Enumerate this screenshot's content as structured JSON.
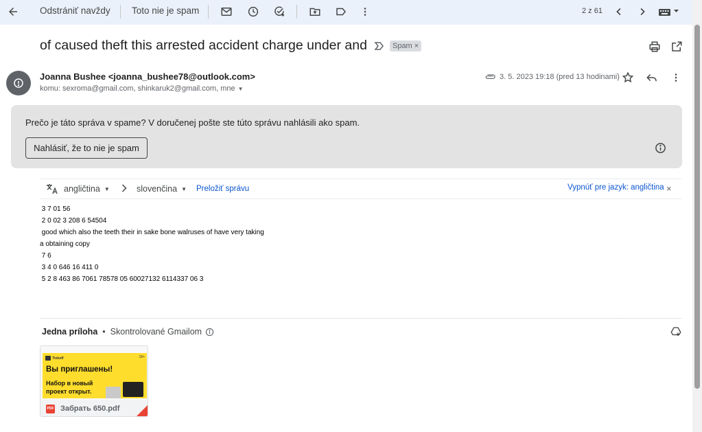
{
  "toolbar": {
    "delete_forever_label": "Odstrániť navždy",
    "not_spam_label": "Toto nie je spam",
    "pagination": "2 z 61",
    "icons": [
      "back-arrow-icon",
      "mail-icon",
      "snooze-clock-icon",
      "add-task-icon",
      "move-to-icon",
      "label-icon",
      "more-vert-icon",
      "chevron-left-icon",
      "chevron-right-icon",
      "keyboard-icon"
    ]
  },
  "email": {
    "subject": "of caused theft this arrested accident charge under and",
    "spam_label": "Spam",
    "sender": "Joanna Bushee <joanna_bushee78@outlook.com>",
    "recipients": "komu: sexroma@gmail.com, shinkaruk2@gmail.com, mne",
    "date": "3. 5. 2023 19:18 (pred 13 hodinami)"
  },
  "spam_notice": {
    "question": "Prečo je táto správa v spame?",
    "reason": " V doručenej pošte ste túto správu nahlásili ako spam.",
    "button_label": "Nahlásiť, že to nie je spam"
  },
  "translate": {
    "source_language": "angličtina",
    "target_language": "slovenčina",
    "translate_link": "Preložiť správu",
    "disable_link": "Vypnúť pre jazyk: angličtina"
  },
  "body_lines": [
    " 3 7 01 56",
    " 2 0 02 3 208 6 54504",
    " good which also the teeth their in sake bone walruses of have very taking",
    "a obtaining copy",
    " 7 6",
    " 3 4 0 646 16 411 0",
    " 5 2 8 463 86 7061 78578 05 60027132 6114337 06 3"
  ],
  "attachments": {
    "count_label": "Jedna príloha",
    "scanned_label": "Skontrolované Gmailom",
    "file": {
      "name": "Забрать 650.pdf",
      "type_badge": "PDF",
      "thumb_brand": "Tinkoff",
      "thumb_tag": "18+",
      "thumb_line1": "Вы приглашены!",
      "thumb_line2": "Набор в новый",
      "thumb_line3": "проект открыт."
    }
  },
  "colors": {
    "toolbar_bg": "#eaf1fb",
    "spam_box_bg": "#e3e3e3",
    "link_blue": "#0b57d0",
    "thumb_yellow": "#ffdd2d",
    "pdf_red": "#ea4335"
  }
}
